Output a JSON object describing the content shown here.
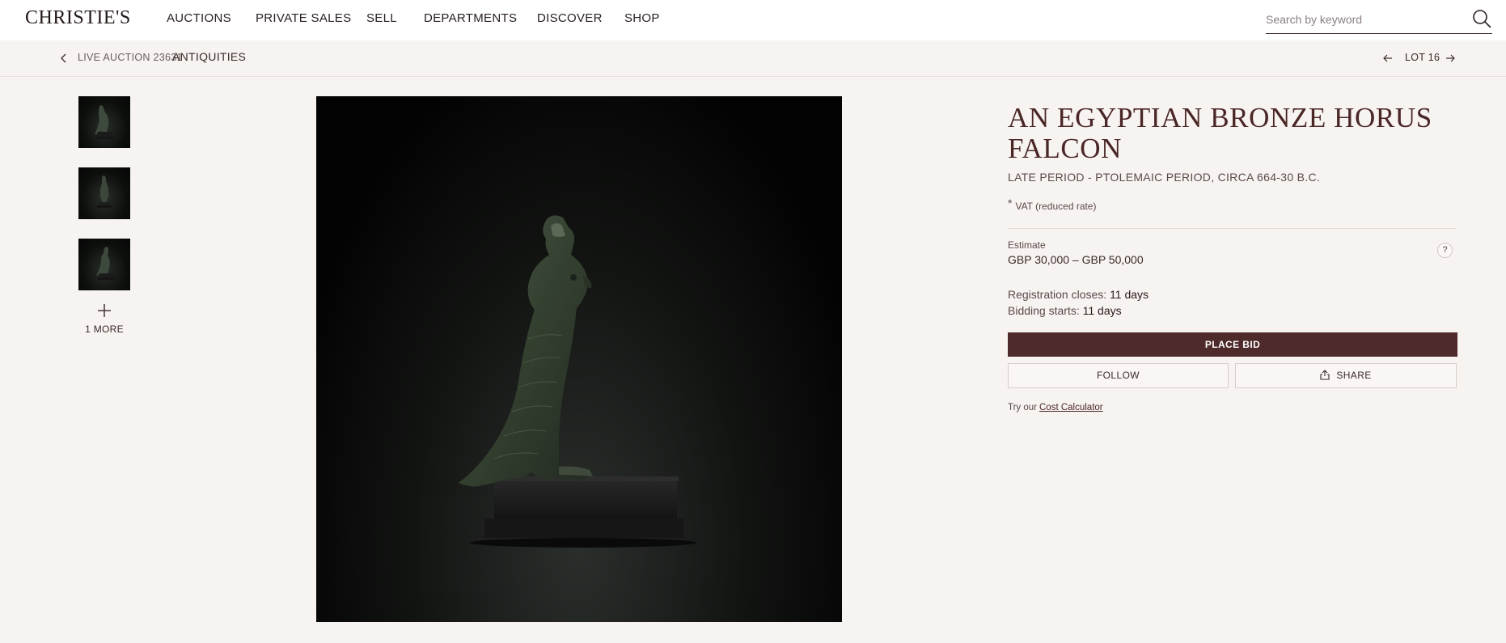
{
  "header": {
    "logo": "CHRISTIE'S",
    "nav": [
      "AUCTIONS",
      "PRIVATE SALES",
      "SELL",
      "DEPARTMENTS",
      "DISCOVER",
      "SHOP"
    ],
    "search_placeholder": "Search by keyword",
    "search_icon": "search-icon"
  },
  "breadcrumb": {
    "back_icon": "chevron-left-icon",
    "sale_label": "LIVE AUCTION 23631",
    "sale_name": "ANTIQUITIES",
    "lot_label": "LOT 16"
  },
  "gallery": {
    "thumbnail_count": 3,
    "more_label": "1 MORE"
  },
  "lot": {
    "title": "AN EGYPTIAN BRONZE HORUS FALCON",
    "subtitle": "LATE PERIOD - PTOLEMAIC PERIOD, CIRCA 664-30 B.C.",
    "vat_star": "*",
    "vat_note": "VAT (reduced rate)",
    "estimate_label": "Estimate",
    "estimate_value": "GBP 30,000 – GBP 50,000",
    "help": "?",
    "registration_label": "Registration closes:",
    "registration_value": "11 days",
    "bidding_label": "Bidding starts:",
    "bidding_value": "11 days",
    "place_bid": "PLACE BID",
    "follow": "FOLLOW",
    "share": "SHARE",
    "try_label": "Try our",
    "calculator_link": "Cost Calculator"
  },
  "colors": {
    "accent": "#4e2a2a",
    "background": "#f7f3f1",
    "title": "#4a2626"
  }
}
